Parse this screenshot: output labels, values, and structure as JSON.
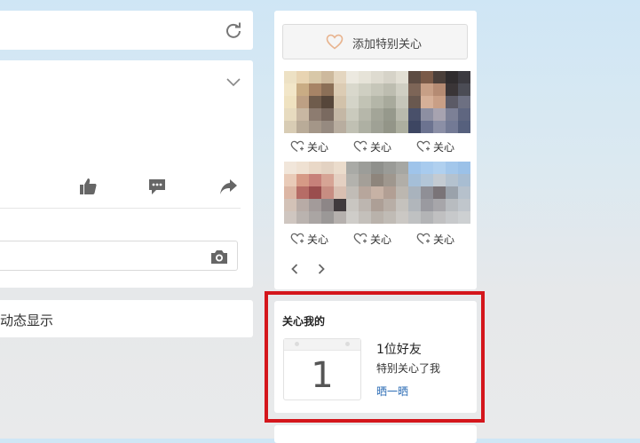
{
  "left": {
    "display_label": "动态显示"
  },
  "icons": {
    "refresh": "refresh-icon",
    "expand": "chevron-down-icon",
    "like": "thumbs-up-icon",
    "comment": "comment-icon",
    "share": "share-icon",
    "camera": "camera-icon",
    "heart": "heart-icon"
  },
  "side": {
    "add_special_label": "添加特别关心",
    "friends": [
      {
        "follow_label": "关心"
      },
      {
        "follow_label": "关心"
      },
      {
        "follow_label": "关心"
      },
      {
        "follow_label": "关心"
      },
      {
        "follow_label": "关心"
      },
      {
        "follow_label": "关心"
      }
    ]
  },
  "care_me": {
    "title": "关心我的",
    "count": "1",
    "friends_count": "1位好友",
    "description": "特别关心了我",
    "show_link": "晒一晒"
  },
  "colors": {
    "highlight": "#d4161c",
    "link": "#2d6db5",
    "heart": "#e8b48f",
    "icon": "#666666"
  }
}
